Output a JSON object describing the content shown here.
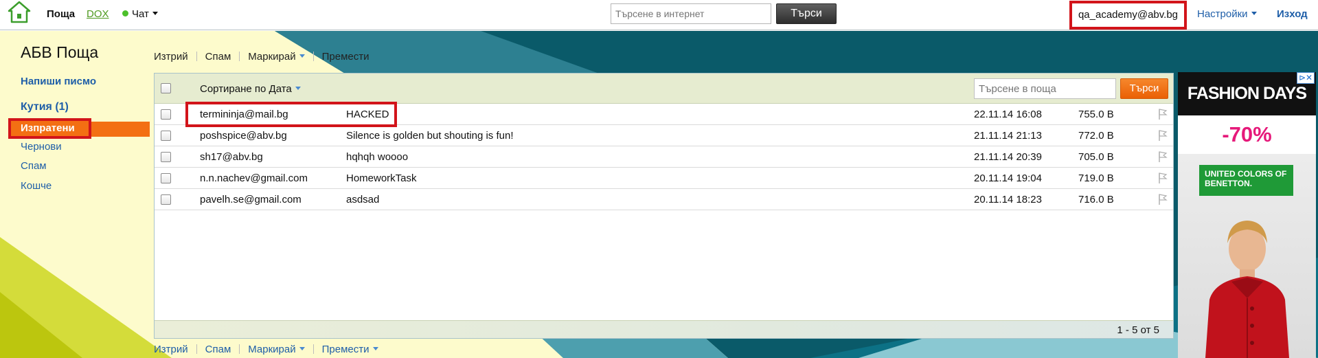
{
  "topbar": {
    "mail_label": "Поща",
    "dox_label": "DOX",
    "chat_label": "Чат",
    "web_search_placeholder": "Търсене в интернет",
    "web_search_button": "Търси",
    "user_email": "qa_academy@abv.bg",
    "settings_label": "Настройки",
    "logout_label": "Изход"
  },
  "sidebar": {
    "brand": "АБВ Поща",
    "compose": "Напиши писмо",
    "inbox": "Кутия (1)",
    "sent": "Изпратени",
    "drafts": "Чернови",
    "spam": "Спам",
    "trash": "Кошче"
  },
  "toolbar_top": {
    "delete": "Изтрий",
    "spam": "Спам",
    "mark": "Маркирай",
    "move": "Премести"
  },
  "toolbar_bottom": {
    "delete": "Изтрий",
    "spam": "Спам",
    "mark": "Маркирай",
    "move": "Премести"
  },
  "mail_list": {
    "sort_label": "Сортиране по Дата",
    "search_placeholder": "Търсене в поща",
    "search_button": "Търси",
    "rows": [
      {
        "from": "termininja@mail.bg",
        "subject": "HACKED",
        "date": "22.11.14 16:08",
        "size": "755.0 B",
        "highlighted": true
      },
      {
        "from": "poshspice@abv.bg",
        "subject": "Silence is golden but shouting is fun!",
        "date": "21.11.14 21:13",
        "size": "772.0 B",
        "highlighted": false
      },
      {
        "from": "sh17@abv.bg",
        "subject": "hqhqh woooo",
        "date": "21.11.14 20:39",
        "size": "705.0 B",
        "highlighted": false
      },
      {
        "from": "n.n.nachev@gmail.com",
        "subject": "HomeworkTask",
        "date": "20.11.14 19:04",
        "size": "719.0 B",
        "highlighted": false
      },
      {
        "from": "pavelh.se@gmail.com",
        "subject": "asdsad",
        "date": "20.11.14 18:23",
        "size": "716.0 B",
        "highlighted": false
      }
    ],
    "pager": "1 - 5 от 5"
  },
  "ad": {
    "badge": "⊳✕",
    "brand": "FASHION DAYS",
    "discount": "-70%",
    "sponsor": "UNITED COLORS OF BENETTON."
  },
  "colors": {
    "accent_orange": "#f36f13",
    "highlight_red": "#d2141a",
    "link_blue": "#1e5ea8",
    "teal_background": "#0d5f6f",
    "lime_background": "#c7d11a"
  },
  "icons": {
    "logo": "home-icon",
    "flag": "flag-icon",
    "chat_status": "online-dot-icon",
    "dropdown": "caret-down-icon"
  }
}
